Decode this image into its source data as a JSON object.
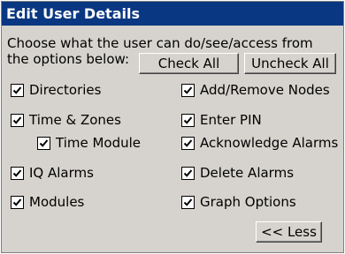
{
  "dialog": {
    "title": "Edit User Details",
    "description": "Choose what the user can do/see/access from the options below:",
    "check_all_label": "Check All",
    "uncheck_all_label": "Uncheck All",
    "less_label": "<< Less"
  },
  "permissions": {
    "directories": {
      "label": "Directories",
      "checked": true
    },
    "time_zones": {
      "label": "Time & Zones",
      "checked": true
    },
    "time_module": {
      "label": "Time Module",
      "checked": true
    },
    "iq_alarms": {
      "label": "IQ Alarms",
      "checked": true
    },
    "modules": {
      "label": "Modules",
      "checked": true
    },
    "add_remove_nodes": {
      "label": "Add/Remove Nodes",
      "checked": true
    },
    "enter_pin": {
      "label": "Enter PIN",
      "checked": true
    },
    "acknowledge_alarms": {
      "label": "Acknowledge Alarms",
      "checked": true
    },
    "delete_alarms": {
      "label": "Delete Alarms",
      "checked": true
    },
    "graph_options": {
      "label": "Graph Options",
      "checked": true
    }
  },
  "colors": {
    "titlebar": "#0a3782",
    "dialog_bg": "#d6d3ce"
  }
}
